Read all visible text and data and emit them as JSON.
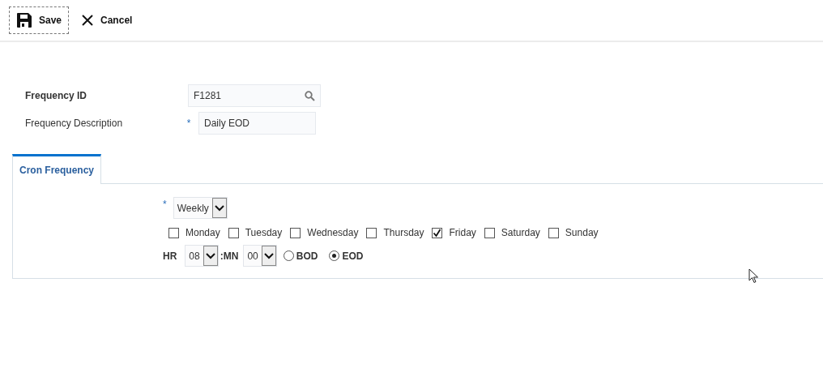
{
  "toolbar": {
    "buttons": [
      {
        "kind": "save",
        "label": "Save",
        "focused": true
      },
      {
        "kind": "cancel",
        "label": "Cancel",
        "focused": false
      }
    ]
  },
  "form": {
    "frequency_id": {
      "label": "Frequency ID",
      "value": "F1281"
    },
    "frequency_description": {
      "label": "Frequency Description",
      "required_mark": "*",
      "value": "Daily EOD"
    }
  },
  "tabs": [
    {
      "label": "Cron Frequency",
      "selected": true
    }
  ],
  "cron": {
    "frequency": {
      "required_mark": "*",
      "value": "Weekly"
    },
    "days": [
      {
        "label": "Monday",
        "checked": false
      },
      {
        "label": "Tuesday",
        "checked": false
      },
      {
        "label": "Wednesday",
        "checked": false
      },
      {
        "label": "Thursday",
        "checked": false
      },
      {
        "label": "Friday",
        "checked": true
      },
      {
        "label": "Saturday",
        "checked": false
      },
      {
        "label": "Sunday",
        "checked": false
      }
    ],
    "time": {
      "hour_label": "HR",
      "hour": "08",
      "separator": ":",
      "minute_label": "MN",
      "minute": "00"
    },
    "anchors": [
      {
        "label": "BOD",
        "selected": false
      },
      {
        "label": "EOD",
        "selected": true
      }
    ]
  }
}
